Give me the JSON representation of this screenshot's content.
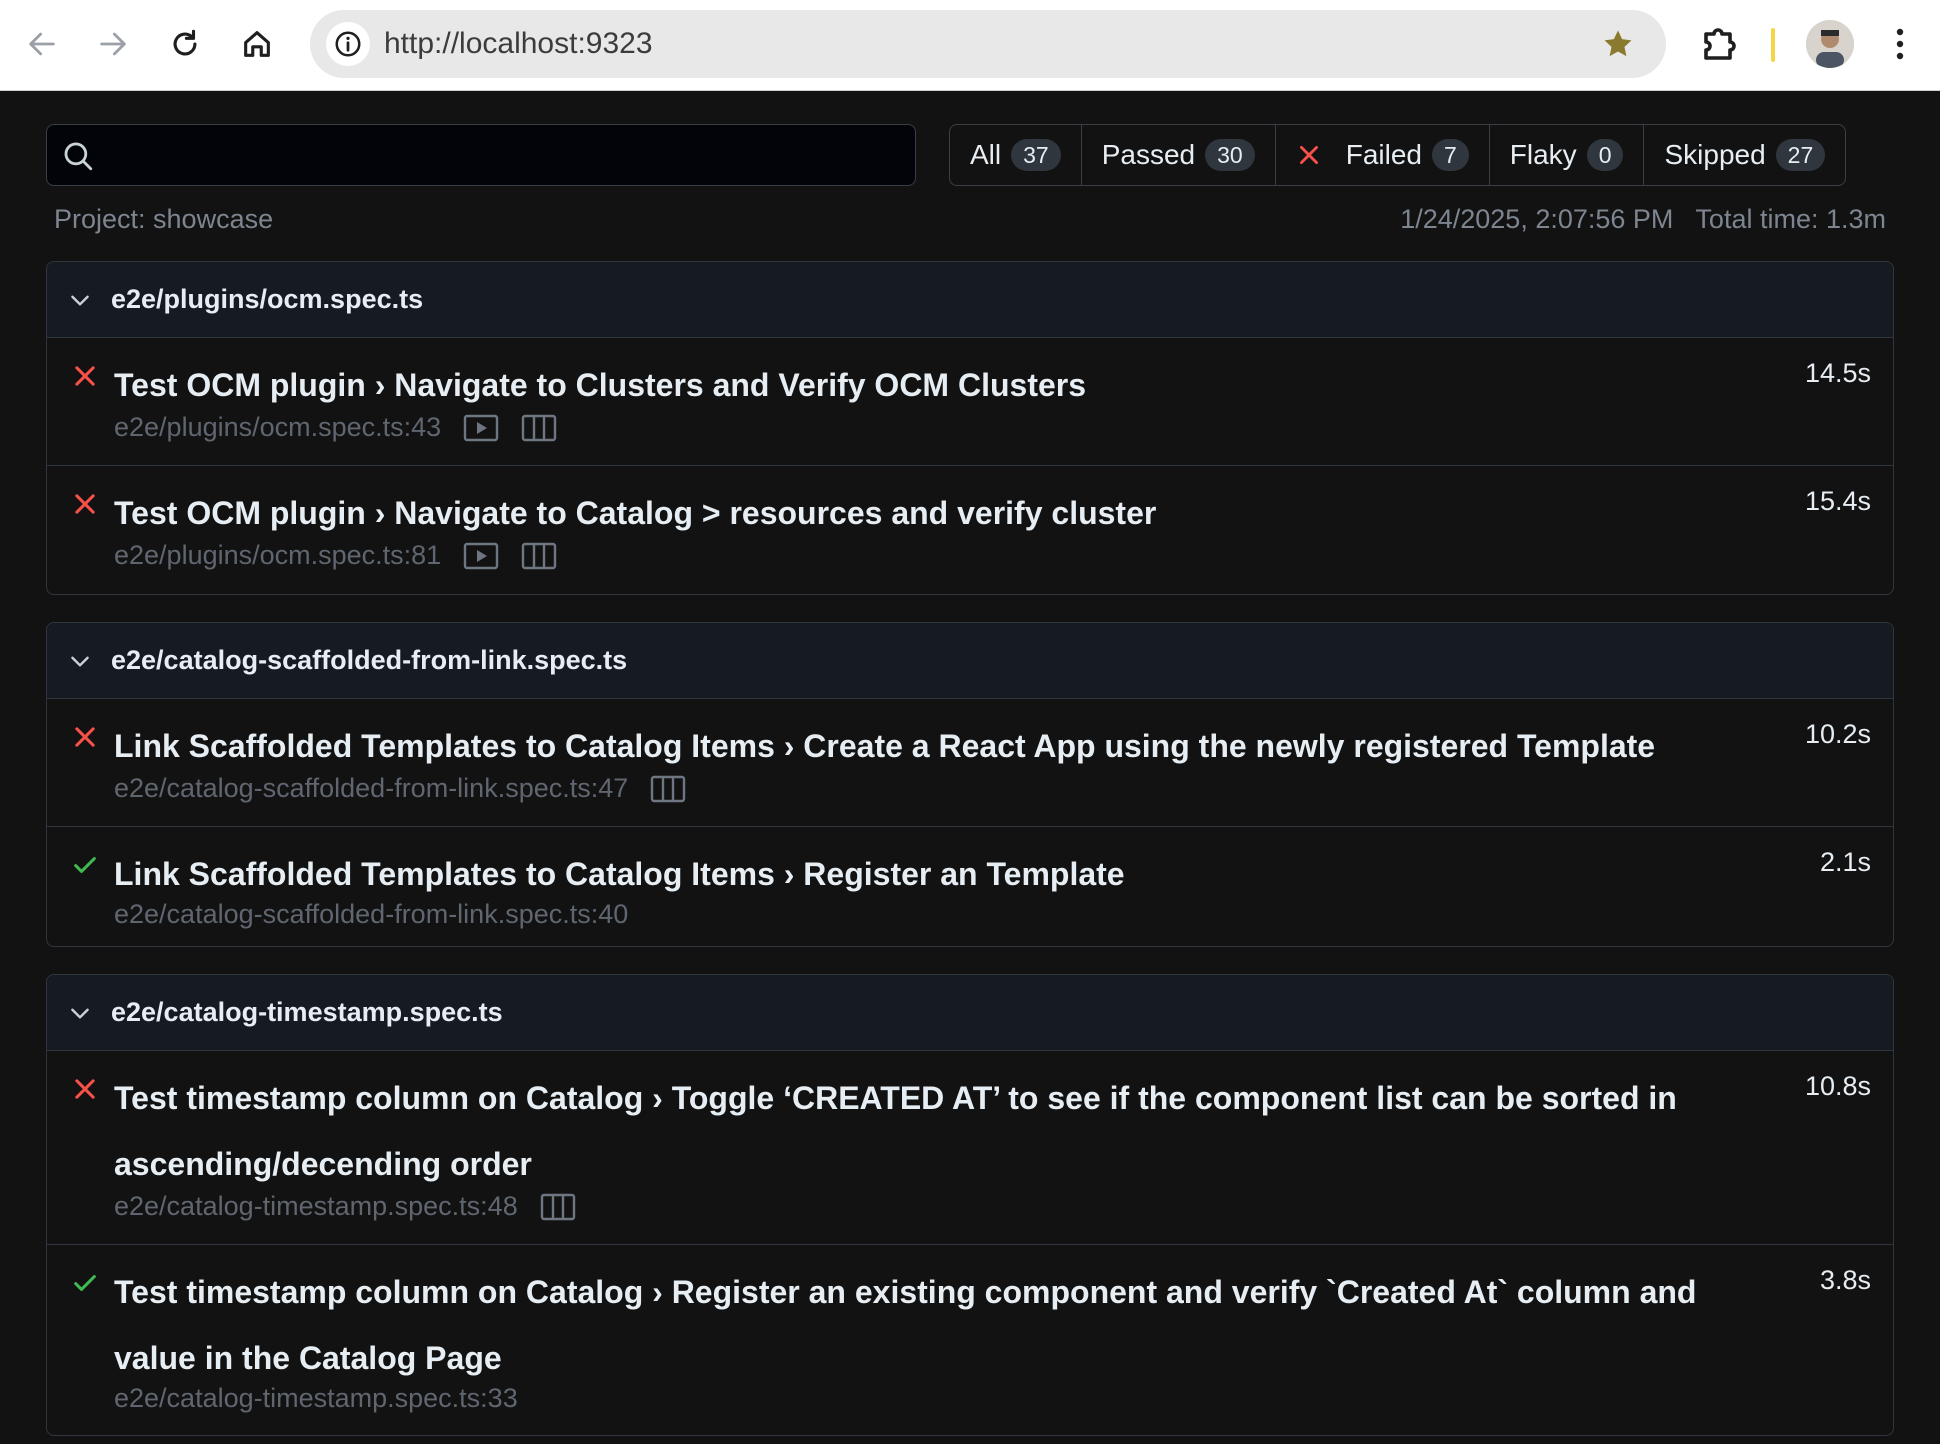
{
  "browser": {
    "url": "http://localhost:9323",
    "icons": [
      "back-arrow-icon",
      "forward-arrow-icon",
      "reload-icon",
      "home-icon",
      "site-info-icon",
      "bookmark-star-icon",
      "extensions-icon",
      "profile-avatar",
      "kebab-menu-icon"
    ]
  },
  "search": {
    "value": "",
    "placeholder": ""
  },
  "filters": [
    {
      "label": "All",
      "count": "37"
    },
    {
      "label": "Passed",
      "count": "30"
    },
    {
      "label": "Failed",
      "count": "7"
    },
    {
      "label": "Flaky",
      "count": "0"
    },
    {
      "label": "Skipped",
      "count": "27"
    }
  ],
  "meta": {
    "project": "Project: showcase",
    "datetime": "1/24/2025, 2:07:56 PM",
    "total_time": "Total time: 1.3m"
  },
  "colors": {
    "fail": "#f85149",
    "pass": "#3fb950",
    "star": "#8a7a2f"
  },
  "files": [
    {
      "name": "e2e/plugins/ocm.spec.ts",
      "tests": [
        {
          "status": "failed",
          "title": "Test OCM plugin › Navigate to Clusters and Verify OCM Clusters",
          "duration": "14.5s",
          "location": "e2e/plugins/ocm.spec.ts:43",
          "attachments": [
            "video-icon",
            "trace-icon"
          ]
        },
        {
          "status": "failed",
          "title": "Test OCM plugin › Navigate to Catalog > resources and verify cluster",
          "duration": "15.4s",
          "location": "e2e/plugins/ocm.spec.ts:81",
          "attachments": [
            "video-icon",
            "trace-icon"
          ]
        }
      ]
    },
    {
      "name": "e2e/catalog-scaffolded-from-link.spec.ts",
      "tests": [
        {
          "status": "failed",
          "title": "Link Scaffolded Templates to Catalog Items › Create a React App using the newly registered Template",
          "duration": "10.2s",
          "location": "e2e/catalog-scaffolded-from-link.spec.ts:47",
          "attachments": [
            "trace-icon"
          ]
        },
        {
          "status": "passed",
          "title": "Link Scaffolded Templates to Catalog Items › Register an Template",
          "duration": "2.1s",
          "location": "e2e/catalog-scaffolded-from-link.spec.ts:40",
          "attachments": []
        }
      ]
    },
    {
      "name": "e2e/catalog-timestamp.spec.ts",
      "tests": [
        {
          "status": "failed",
          "title": "Test timestamp column on Catalog › Toggle ‘CREATED AT’ to see if the component list can be sorted in ascending/decending order",
          "duration": "10.8s",
          "location": "e2e/catalog-timestamp.spec.ts:48",
          "attachments": [
            "trace-icon"
          ]
        },
        {
          "status": "passed",
          "title": "Test timestamp column on Catalog › Register an existing component and verify `Created At` column and value in the Catalog Page",
          "duration": "3.8s",
          "location": "e2e/catalog-timestamp.spec.ts:33",
          "attachments": []
        }
      ]
    }
  ]
}
